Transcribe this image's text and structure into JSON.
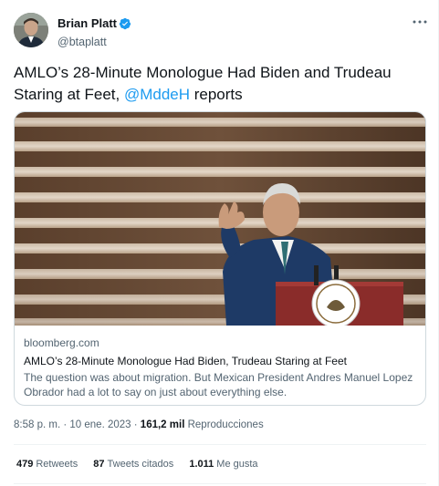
{
  "author": {
    "display_name": "Brian Platt",
    "handle": "@btaplatt",
    "verified": true,
    "avatar_icon": "profile-photo",
    "verified_icon": "verified-badge-icon",
    "more_icon": "more-horizontal-icon"
  },
  "tweet": {
    "text_before": "AMLO’s 28-Minute Monologue Had Biden and Trudeau Staring at Feet, ",
    "mention": "@MddeH",
    "text_after": " reports"
  },
  "card": {
    "domain": "bloomberg.com",
    "title": "AMLO’s 28-Minute Monologue Had Biden, Trudeau Staring at Feet",
    "description": "The question was about migration. But Mexican President Andres Manuel Lopez Obrador had a lot to say on just about everything else."
  },
  "meta": {
    "time": "8:58 p. m.",
    "separator": "·",
    "date": "10 ene. 2023",
    "views_count": "161,2 mil",
    "views_label": "Reproducciones"
  },
  "stats": {
    "retweets_count": "479",
    "retweets_label": "Retweets",
    "quotes_count": "87",
    "quotes_label": "Tweets citados",
    "likes_count": "1.011",
    "likes_label": "Me gusta"
  },
  "colors": {
    "accent": "#1d9bf0",
    "text_primary": "#0f1419",
    "text_secondary": "#536471",
    "border": "#cfd9de"
  }
}
